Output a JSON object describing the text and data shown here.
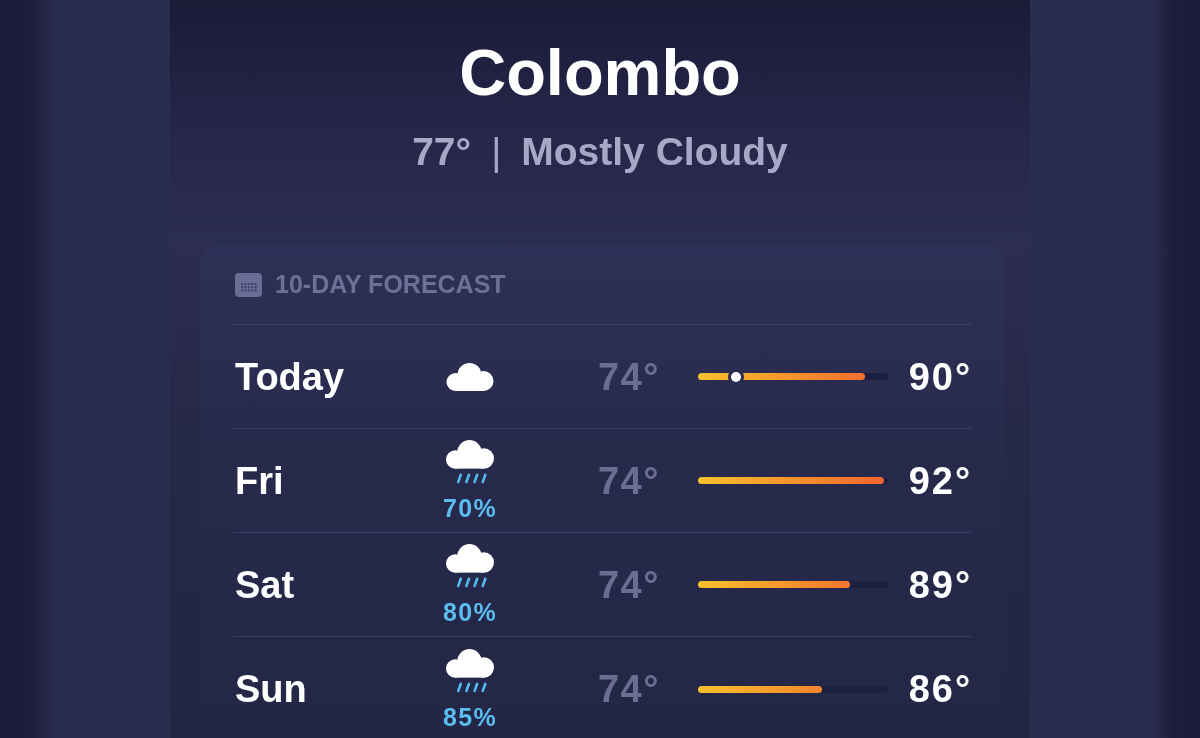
{
  "location": {
    "city": "Colombo",
    "temperature": "77°",
    "separator": "|",
    "condition": "Mostly Cloudy"
  },
  "forecast": {
    "title": "10-DAY FORECAST",
    "days": [
      {
        "day": "Today",
        "kind": "cloudy",
        "low": "74°",
        "high": "90°",
        "level": 0.88,
        "now_marker": {
          "level": 0.2
        }
      },
      {
        "day": "Fri",
        "kind": "rain",
        "chance": "70%",
        "low": "74°",
        "high": "92°",
        "level": 0.98
      },
      {
        "day": "Sat",
        "kind": "rain",
        "chance": "80%",
        "low": "74°",
        "high": "89°",
        "level": 0.8
      },
      {
        "day": "Sun",
        "kind": "rain",
        "chance": "85%",
        "low": "74°",
        "high": "86°",
        "level": 0.65
      }
    ]
  }
}
